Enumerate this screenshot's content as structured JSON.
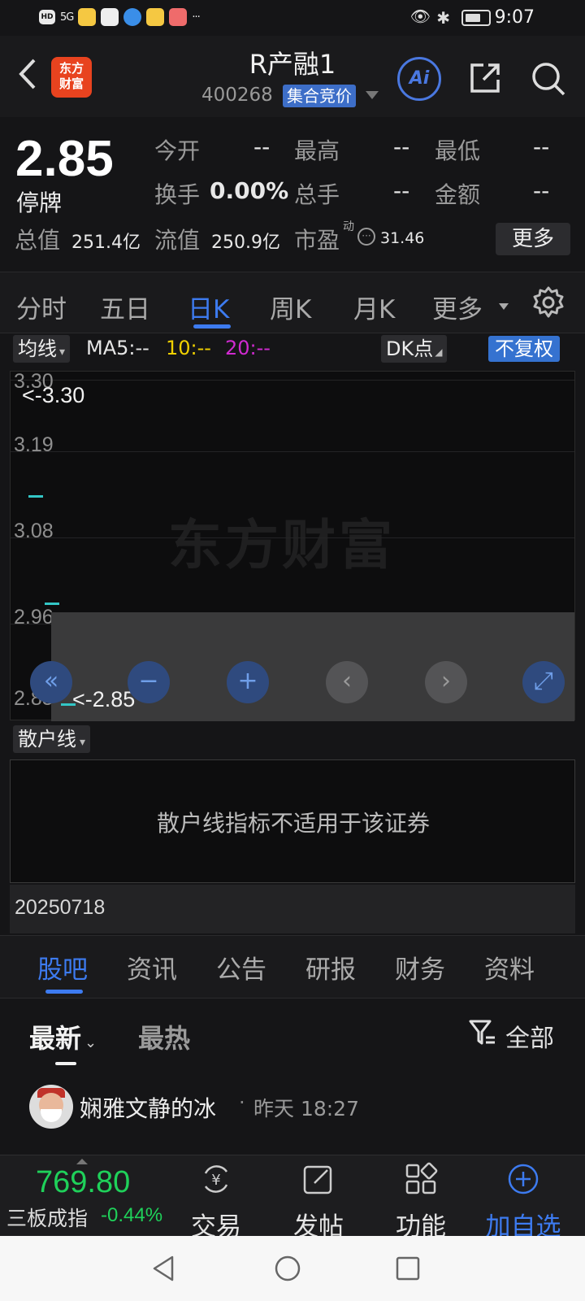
{
  "status_bar": {
    "hd": "HD",
    "signal": "5G",
    "more": "···",
    "time": "9:07"
  },
  "header": {
    "back_icon": "chevron-left-icon",
    "logo_line1": "东方",
    "logo_line2": "财富",
    "title": "R产融1",
    "code": "400268",
    "badge": "集合竞价",
    "ai_label": "Ai"
  },
  "quote": {
    "price": "2.85",
    "status": "停牌",
    "open_label": "今开",
    "open_value": "--",
    "high_label": "最高",
    "high_value": "--",
    "low_label": "最低",
    "low_value": "--",
    "turnover_label": "换手",
    "turnover_value": "0.00%",
    "volume_label": "总手",
    "volume_value": "--",
    "amount_label": "金额",
    "amount_value": "--",
    "mktcap_label": "总值",
    "mktcap_value": "251.4亿",
    "float_label": "流值",
    "float_value": "250.9亿",
    "pe_label": "市盈",
    "pe_dyn": "动",
    "pe_value": "31.46",
    "more_button": "更多"
  },
  "period_tabs": {
    "items": [
      "分时",
      "五日",
      "日K",
      "周K",
      "月K",
      "更多"
    ],
    "active_index": 2
  },
  "indicator_bar": {
    "ma_select": "均线",
    "ma5": "MA5:--",
    "ma10": "10:--",
    "ma20": "20:--",
    "dk": "DK点",
    "adjust": "不复权",
    "colors": {
      "ma5": "#e6e6e6",
      "ma10": "#f0d000",
      "ma20": "#d02ad0"
    }
  },
  "chart": {
    "watermark": "东方财富",
    "high_marker": "<-3.30",
    "low_marker": "<-2.85",
    "ticks": [
      "3.30",
      "3.19",
      "3.08",
      "2.96",
      "2.85"
    ],
    "controls": [
      "«",
      "−",
      "+",
      "‹",
      "›",
      "⤢"
    ]
  },
  "chart_data": {
    "type": "candlestick",
    "ylim": [
      2.85,
      3.3
    ],
    "yticks": [
      3.3,
      3.19,
      3.08,
      2.96,
      2.85
    ],
    "max_label": 3.3,
    "min_label": 2.85,
    "candles": [
      {
        "price": 3.14
      },
      {
        "price": 2.99
      },
      {
        "price": 2.85
      }
    ]
  },
  "retail": {
    "select": "散户线",
    "message": "散户线指标不适用于该证券",
    "date": "20250718"
  },
  "content_tabs": {
    "items": [
      "股吧",
      "资讯",
      "公告",
      "研报",
      "财务",
      "资料"
    ],
    "active_index": 0
  },
  "sort": {
    "latest": "最新",
    "hot": "最热",
    "filter": "全部"
  },
  "post": {
    "author": "娴雅文静的冰",
    "sep": "·",
    "time": "昨天 18:27"
  },
  "bottom_bar": {
    "index_value": "769.80",
    "index_name": "三板成指",
    "index_change": "-0.44%",
    "trade": "交易",
    "post": "发帖",
    "functions": "功能",
    "add_watch": "加自选"
  },
  "colors": {
    "accent": "#3d7bf0",
    "down": "#1fd15a",
    "logo": "#e8431f",
    "kline": "#33c6c6"
  }
}
